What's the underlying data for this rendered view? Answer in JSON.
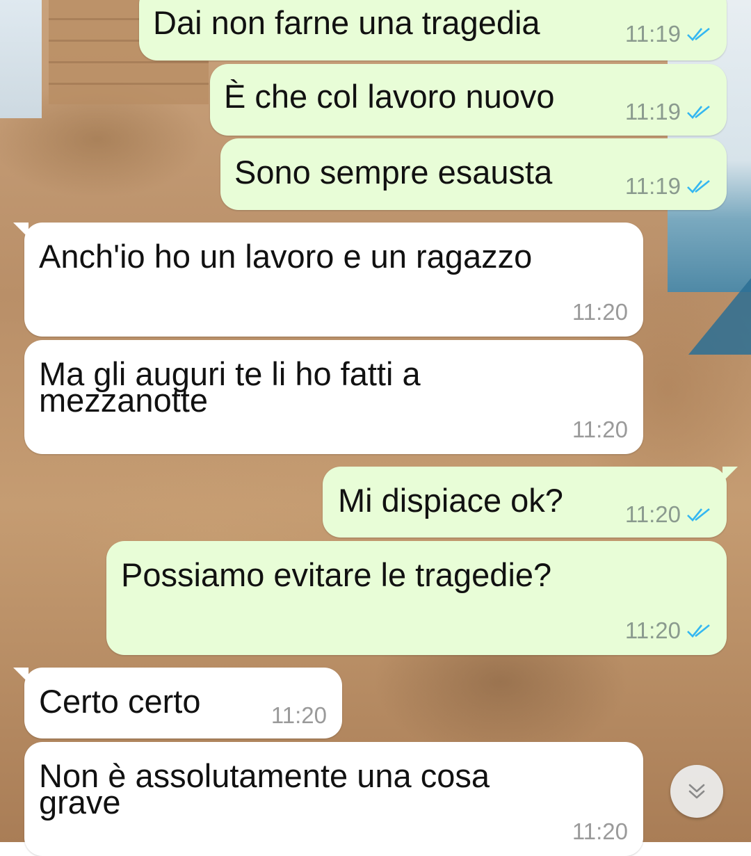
{
  "messages": [
    {
      "id": "m1",
      "direction": "out",
      "text": "Dai non farne una tragedia",
      "time": "11:19",
      "status": "read"
    },
    {
      "id": "m2",
      "direction": "out",
      "text": "È che col lavoro nuovo",
      "time": "11:19",
      "status": "read"
    },
    {
      "id": "m3",
      "direction": "out",
      "text": "Sono sempre esausta",
      "time": "11:19",
      "status": "read"
    },
    {
      "id": "m4",
      "direction": "in",
      "text": "Anch'io ho un lavoro e un ragazzo",
      "time": "11:20"
    },
    {
      "id": "m5",
      "direction": "in",
      "text": "Ma gli auguri te li ho fatti a\nmezzanotte",
      "time": "11:20"
    },
    {
      "id": "m6",
      "direction": "out",
      "text": "Mi dispiace ok?",
      "time": "11:20",
      "status": "read"
    },
    {
      "id": "m7",
      "direction": "out",
      "text": "Possiamo evitare le tragedie?",
      "time": "11:20",
      "status": "read"
    },
    {
      "id": "m8",
      "direction": "in",
      "text": "Certo certo",
      "time": "11:20"
    },
    {
      "id": "m9",
      "direction": "in",
      "text": "Non è assolutamente una cosa\ngrave",
      "time": "11:20"
    }
  ],
  "colors": {
    "outgoing_bubble": "#e8fdd7",
    "incoming_bubble": "#ffffff",
    "read_ticks": "#34b7f1"
  },
  "icons": {
    "read_status": "double-check-icon",
    "scroll_down": "chevron-double-down-icon"
  }
}
